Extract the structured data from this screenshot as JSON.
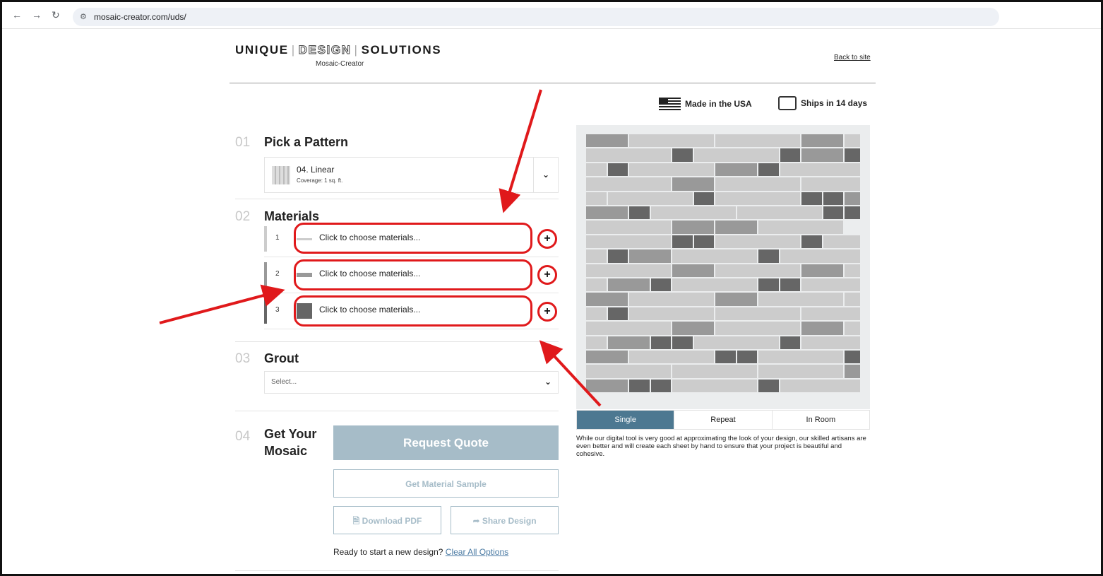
{
  "browser": {
    "back_icon": "arrow-left-icon",
    "forward_icon": "arrow-right-icon",
    "reload_icon": "reload-icon",
    "url": "mosaic-creator.com/uds/"
  },
  "header": {
    "logo_word1": "UNIQUE",
    "logo_word2": "DESIGN",
    "logo_word3": "SOLUTIONS",
    "logo_sub": "Mosaic-Creator",
    "back_link": "Back to site"
  },
  "badges": {
    "made": "Made in the USA",
    "ships": "Ships in 14 days"
  },
  "steps": {
    "pattern": {
      "num": "01",
      "title": "Pick a Pattern",
      "name": "04. Linear",
      "coverage": "Coverage: 1 sq. ft."
    },
    "materials": {
      "num": "02",
      "title": "Materials",
      "rows": [
        {
          "num": "1",
          "label": "Click to choose materials...",
          "color": "#cccccc"
        },
        {
          "num": "2",
          "label": "Click to choose materials...",
          "color": "#999999"
        },
        {
          "num": "3",
          "label": "Click to choose materials...",
          "color": "#666666"
        }
      ],
      "add_symbol": "+"
    },
    "grout": {
      "num": "03",
      "title": "Grout",
      "placeholder": "Select..."
    },
    "get": {
      "num": "04",
      "title_line1": "Get Your",
      "title_line2": "Mosaic",
      "request_quote": "Request Quote",
      "sample": "Get Material Sample",
      "download": "Download PDF",
      "share": "Share Design",
      "restart_text": "Ready to start a new design?",
      "clear_link": "Clear All Options"
    }
  },
  "preview": {
    "tabs": [
      "Single",
      "Repeat",
      "In Room"
    ],
    "active_tab": "Single",
    "disclaimer": "While our digital tool is very good at approximating the look of your design, our skilled artisans are even better and will create each sheet by hand to ensure that your project is beautiful and cohesive."
  },
  "colors": {
    "light": "#cccccc",
    "mid": "#999999",
    "dark": "#666666",
    "accent": "#4d7891",
    "highlight": "#e0191b"
  }
}
